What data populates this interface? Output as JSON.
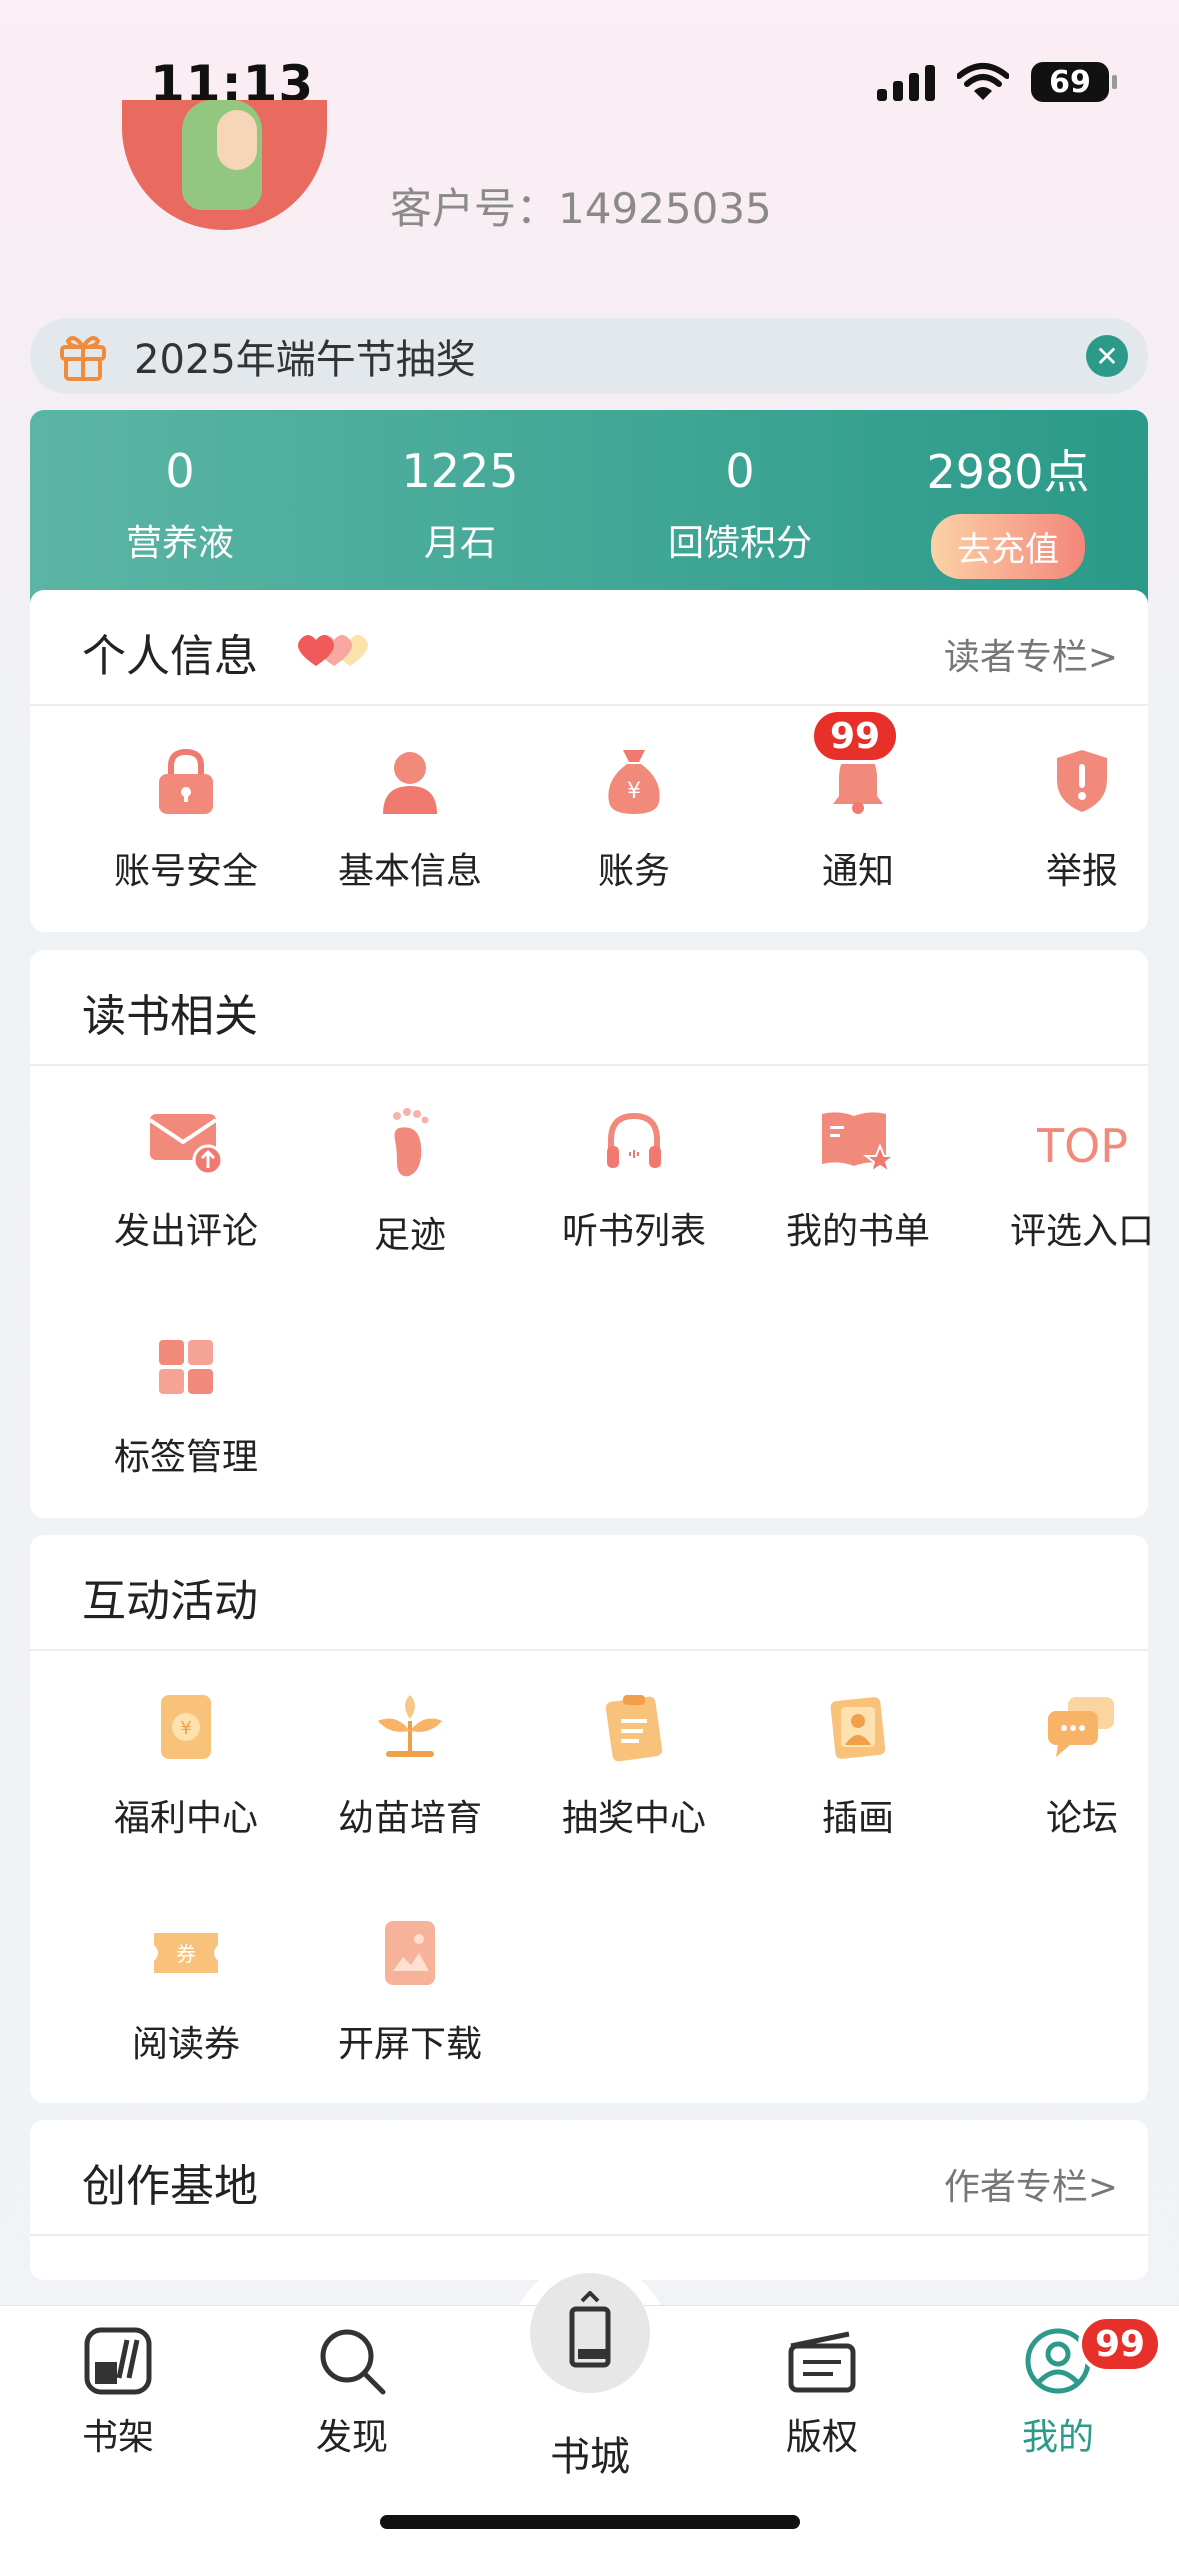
{
  "status": {
    "time": "11:13",
    "battery": "69"
  },
  "profile": {
    "customer_id": "客户号：14925035"
  },
  "promo": {
    "text": "2025年端午节抽奖"
  },
  "wallet": [
    {
      "value": "0",
      "label": "营养液"
    },
    {
      "value": "1225",
      "label": "月石"
    },
    {
      "value": "0",
      "label": "回馈积分"
    },
    {
      "value": "2980点",
      "label": "去充值"
    }
  ],
  "personal": {
    "title": "个人信息",
    "link": "读者专栏>",
    "items": [
      {
        "label": "账号安全",
        "icon": "lock-icon"
      },
      {
        "label": "基本信息",
        "icon": "person-icon"
      },
      {
        "label": "账务",
        "icon": "money-bag-icon"
      },
      {
        "label": "通知",
        "icon": "bell-icon",
        "badge": "99"
      },
      {
        "label": "举报",
        "icon": "shield-alert-icon"
      }
    ]
  },
  "reading": {
    "title": "读书相关",
    "items": [
      {
        "label": "发出评论",
        "icon": "mail-send-icon"
      },
      {
        "label": "足迹",
        "icon": "footprint-icon"
      },
      {
        "label": "听书列表",
        "icon": "headphones-icon"
      },
      {
        "label": "我的书单",
        "icon": "book-star-icon"
      },
      {
        "label": "评选入口",
        "icon": "top-icon"
      },
      {
        "label": "标签管理",
        "icon": "grid-icon"
      }
    ]
  },
  "interactive": {
    "title": "互动活动",
    "items": [
      {
        "label": "福利中心",
        "icon": "red-envelope-icon"
      },
      {
        "label": "幼苗培育",
        "icon": "sprout-icon"
      },
      {
        "label": "抽奖中心",
        "icon": "clipboard-icon"
      },
      {
        "label": "插画",
        "icon": "picture-icon"
      },
      {
        "label": "论坛",
        "icon": "chat-icon"
      },
      {
        "label": "阅读券",
        "icon": "ticket-icon"
      },
      {
        "label": "开屏下载",
        "icon": "image-icon"
      }
    ]
  },
  "creation": {
    "title": "创作基地",
    "link": "作者专栏>"
  },
  "tabbar": {
    "items": [
      {
        "label": "书架",
        "icon": "bookshelf-icon"
      },
      {
        "label": "发现",
        "icon": "search-icon"
      },
      {
        "label": "书城",
        "icon": "book-icon"
      },
      {
        "label": "版权",
        "icon": "clapperboard-icon"
      },
      {
        "label": "我的",
        "icon": "user-icon",
        "badge": "99"
      }
    ]
  },
  "colors": {
    "accent": "#2b9a89",
    "badge": "#e8302a",
    "icon_red": "#f07a6f",
    "icon_orange": "#f6b766"
  }
}
